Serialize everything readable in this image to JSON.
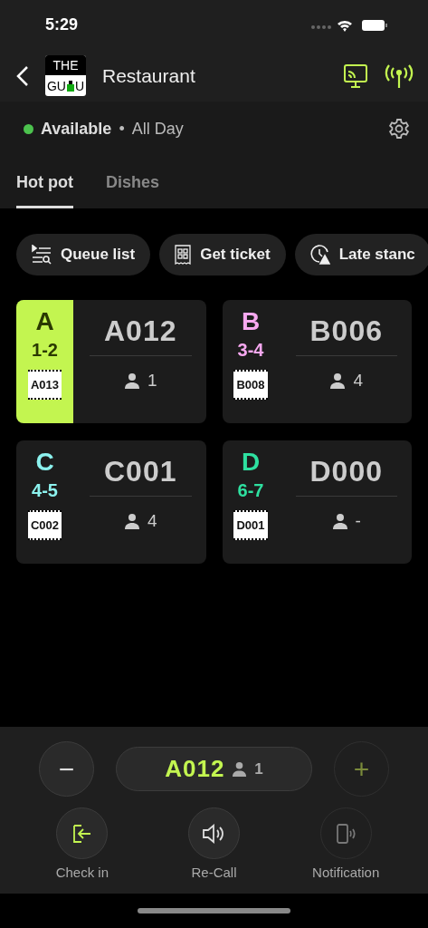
{
  "status_bar": {
    "time": "5:29"
  },
  "header": {
    "logo": {
      "top": "THE",
      "bottom_left": "GU",
      "bottom_right": "U"
    },
    "title": "Restaurant"
  },
  "availability": {
    "status": "Available",
    "separator": "•",
    "period": "All Day",
    "color": "#4cc24e"
  },
  "tabs": [
    {
      "label": "Hot pot",
      "selected": true
    },
    {
      "label": "Dishes",
      "selected": false
    }
  ],
  "actions": [
    {
      "kind": "queue",
      "label": "Queue list"
    },
    {
      "kind": "ticket",
      "label": "Get ticket"
    },
    {
      "kind": "late",
      "label": "Late stanc"
    }
  ],
  "groups": [
    {
      "letter": "A",
      "range": "1-2",
      "next_ticket": "A013",
      "current": "A012",
      "people": "1",
      "color": "#c3f550",
      "selected": true
    },
    {
      "letter": "B",
      "range": "3-4",
      "next_ticket": "B008",
      "current": "B006",
      "people": "4",
      "color": "#f7a8f0",
      "selected": false
    },
    {
      "letter": "C",
      "range": "4-5",
      "next_ticket": "C002",
      "current": "C001",
      "people": "4",
      "color": "#8cf2ee",
      "selected": false
    },
    {
      "letter": "D",
      "range": "6-7",
      "next_ticket": "D001",
      "current": "D000",
      "people": "-",
      "color": "#2ee0a0",
      "selected": false
    }
  ],
  "call_panel": {
    "minus": {
      "label": "−",
      "disabled": false
    },
    "current": {
      "ticket": "A012",
      "people": "1"
    },
    "plus": {
      "label": "+",
      "disabled": true
    },
    "buttons": [
      {
        "kind": "checkin",
        "label": "Check in",
        "disabled": false
      },
      {
        "kind": "recall",
        "label": "Re-Call",
        "disabled": false
      },
      {
        "kind": "notify",
        "label": "Notification",
        "disabled": true
      }
    ]
  }
}
